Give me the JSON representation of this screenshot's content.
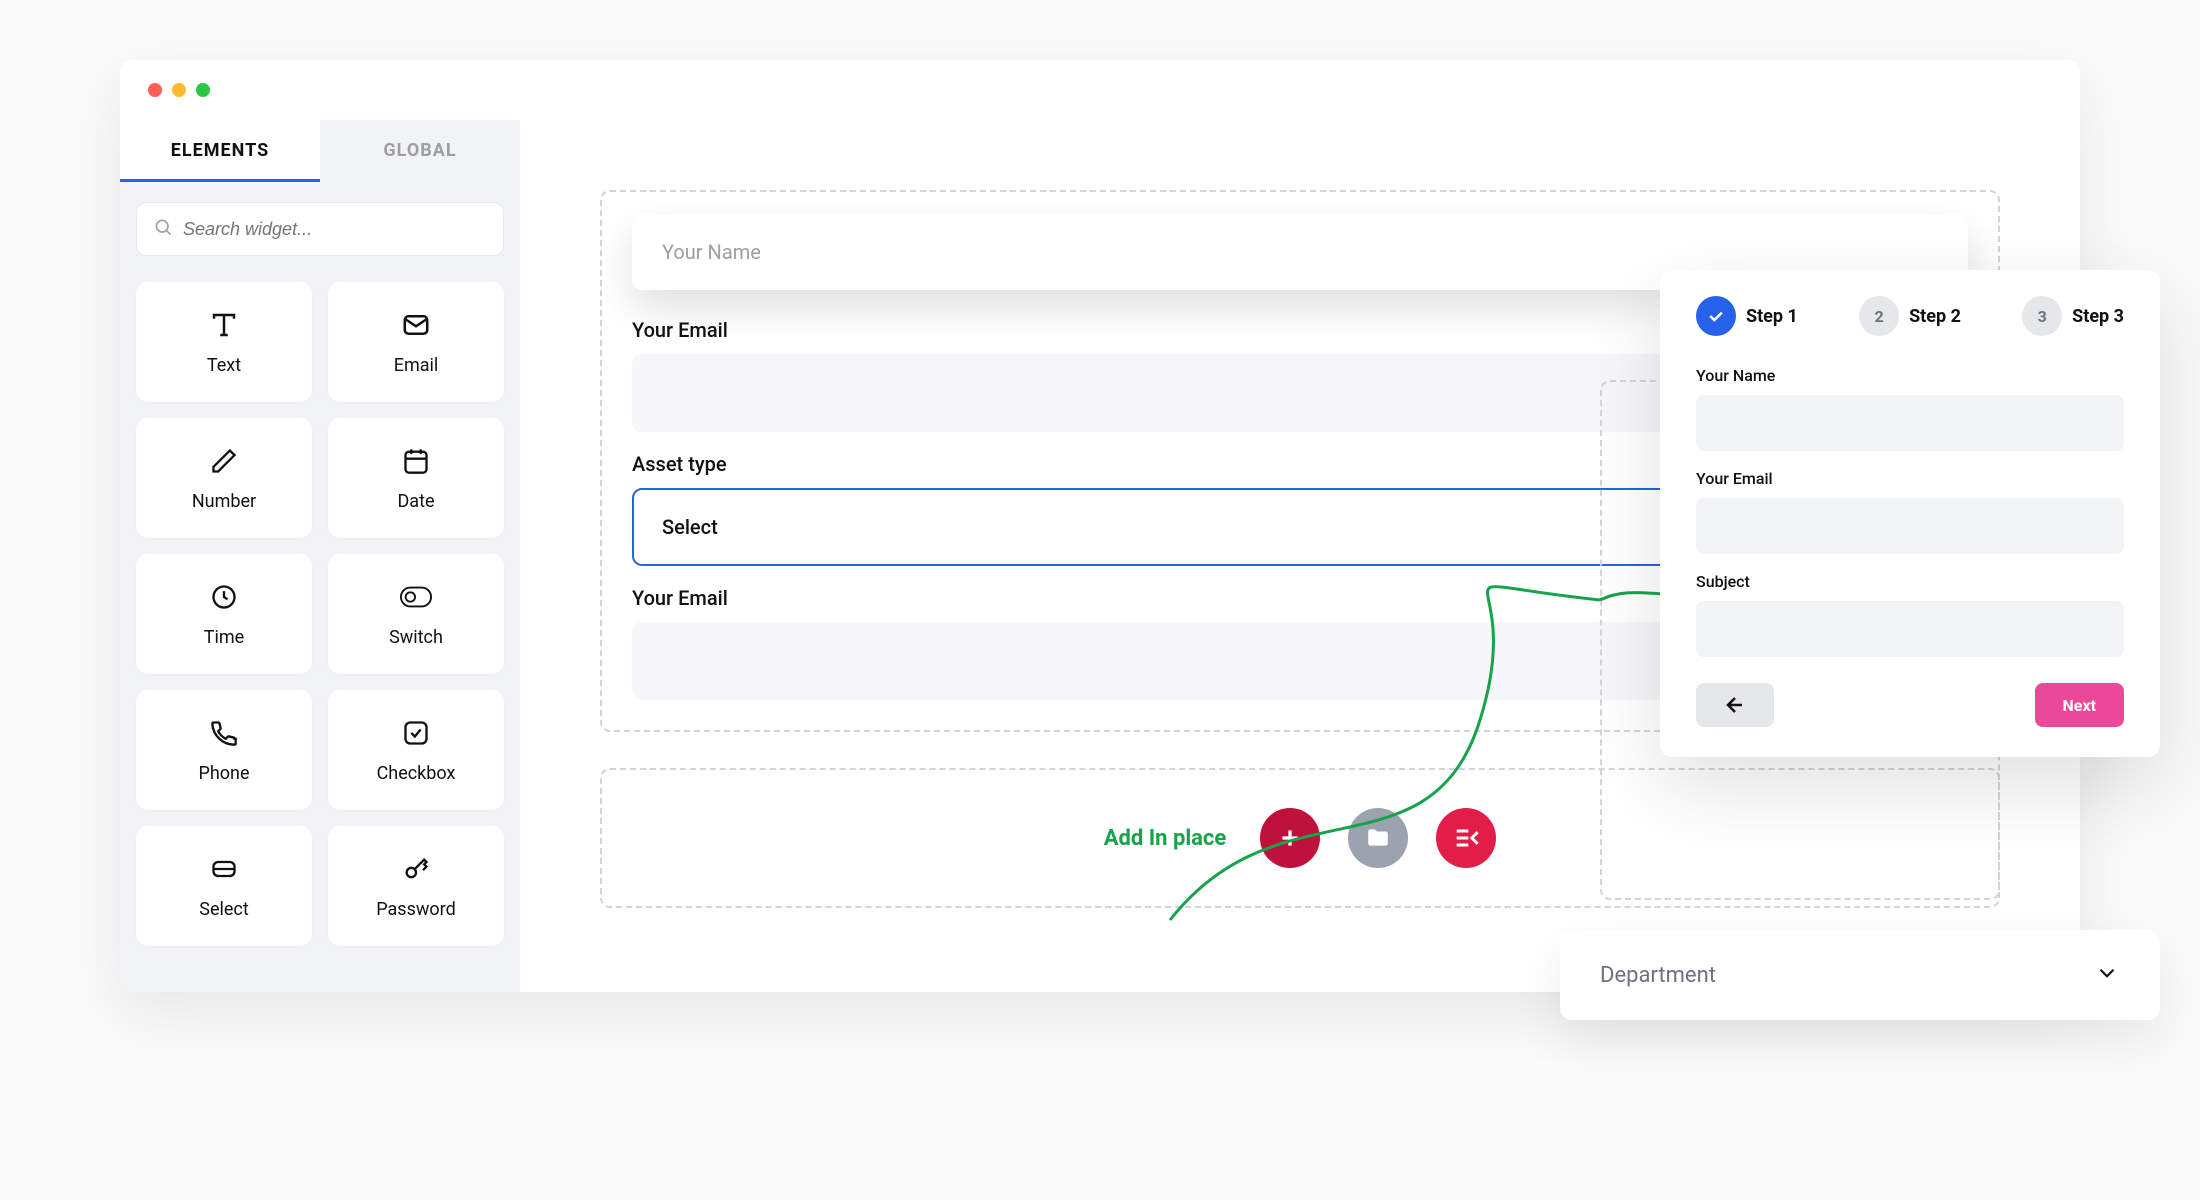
{
  "sidebar": {
    "tabs": {
      "elements": "ELEMENTS",
      "global": "GLOBAL"
    },
    "search_placeholder": "Search widget...",
    "widgets": [
      {
        "label": "Text"
      },
      {
        "label": "Email"
      },
      {
        "label": "Number"
      },
      {
        "label": "Date"
      },
      {
        "label": "Time"
      },
      {
        "label": "Switch"
      },
      {
        "label": "Phone"
      },
      {
        "label": "Checkbox"
      },
      {
        "label": "Select"
      },
      {
        "label": "Password"
      }
    ]
  },
  "canvas": {
    "name_placeholder": "Your Name",
    "email_label": "Your Email",
    "asset_type_label": "Asset type",
    "select_placeholder": "Select",
    "email_label_2": "Your Email",
    "add_in_place": "Add In place"
  },
  "preview": {
    "steps": [
      {
        "badge": "1",
        "label": "Step 1",
        "done": true
      },
      {
        "badge": "2",
        "label": "Step 2",
        "done": false
      },
      {
        "badge": "3",
        "label": "Step 3",
        "done": false
      }
    ],
    "fields": {
      "name": "Your Name",
      "email": "Your Email",
      "subject": "Subject"
    },
    "next": "Next"
  },
  "department": {
    "label": "Department"
  },
  "colors": {
    "primary": "#2563eb",
    "accent_green": "#16a34a",
    "pink": "#ec4899",
    "crimson": "#be123c"
  }
}
